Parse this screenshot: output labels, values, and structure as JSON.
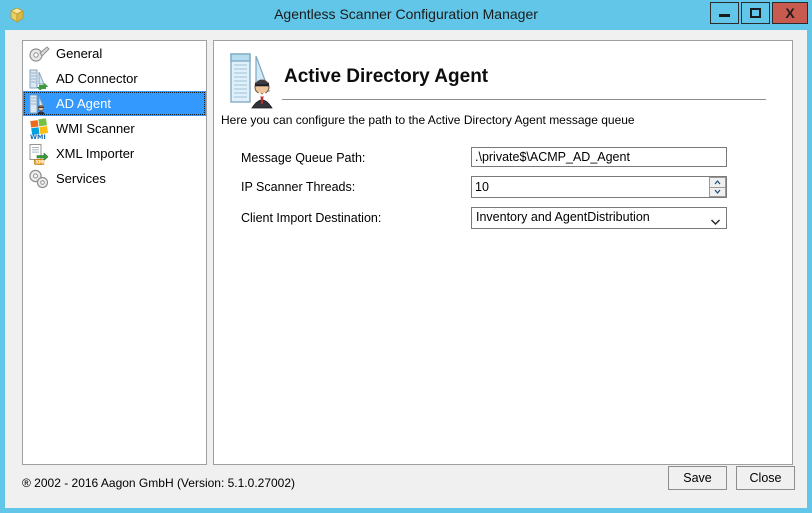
{
  "window": {
    "title": "Agentless Scanner Configuration Manager",
    "icon": "shield-box-icon",
    "controls": {
      "minimize": "minimize-icon",
      "maximize": "maximize-icon",
      "close": "X"
    },
    "accent_titlebar": "#62c6e8",
    "close_button_color": "#c75b50"
  },
  "sidebar": {
    "selected_index": 2,
    "selection_color": "#3399ff",
    "items": [
      {
        "label": "General",
        "icon": "wrench-gear-icon"
      },
      {
        "label": "AD Connector",
        "icon": "server-sync-icon"
      },
      {
        "label": "AD Agent",
        "icon": "server-agent-icon"
      },
      {
        "label": "WMI Scanner",
        "icon": "windows-wmi-icon"
      },
      {
        "label": "XML Importer",
        "icon": "document-xml-import-icon"
      },
      {
        "label": "Services",
        "icon": "gears-icon"
      }
    ]
  },
  "page": {
    "icon": "server-agent-large-icon",
    "title": "Active Directory Agent",
    "description": "Here you can configure the path to the Active Directory Agent message queue",
    "fields": [
      {
        "label": "Message Queue Path:",
        "type": "text",
        "value": ".\\private$\\ACMP_AD_Agent",
        "placeholder": ""
      },
      {
        "label": "IP Scanner Threads:",
        "type": "spinner",
        "value": "10",
        "placeholder": ""
      },
      {
        "label": "Client Import Destination:",
        "type": "combobox",
        "value": "Inventory and AgentDistribution",
        "placeholder": ""
      }
    ]
  },
  "footer": {
    "copyright": "® 2002 - 2016 Aagon GmbH (Version: 5.1.0.27002)",
    "save_label": "Save",
    "close_label": "Close"
  }
}
